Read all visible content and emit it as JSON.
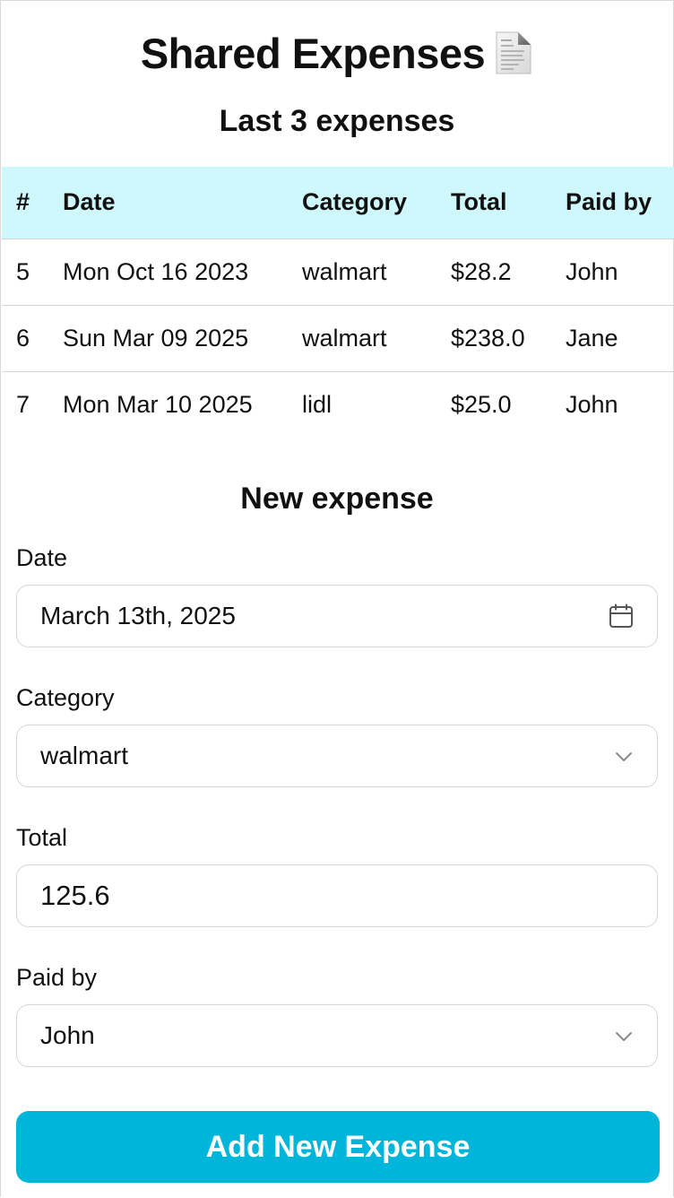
{
  "header": {
    "title": "Shared Expenses",
    "title_icon": "document-icon"
  },
  "recent": {
    "title": "Last 3 expenses",
    "columns": [
      "#",
      "Date",
      "Category",
      "Total",
      "Paid by"
    ],
    "rows": [
      {
        "num": "5",
        "date": "Mon Oct 16 2023",
        "category": "walmart",
        "total": "$28.2",
        "paid_by": "John"
      },
      {
        "num": "6",
        "date": "Sun Mar 09 2025",
        "category": "walmart",
        "total": "$238.0",
        "paid_by": "Jane"
      },
      {
        "num": "7",
        "date": "Mon Mar 10 2025",
        "category": "lidl",
        "total": "$25.0",
        "paid_by": "John"
      }
    ]
  },
  "form": {
    "title": "New expense",
    "date_label": "Date",
    "date_value": "March 13th, 2025",
    "category_label": "Category",
    "category_value": "walmart",
    "total_label": "Total",
    "total_value": "125.6",
    "paid_by_label": "Paid by",
    "paid_by_value": "John",
    "submit_label": "Add New Expense"
  },
  "colors": {
    "table_header_bg": "#cff8fc",
    "button_bg": "#00b5da",
    "button_text": "#ffffff"
  }
}
